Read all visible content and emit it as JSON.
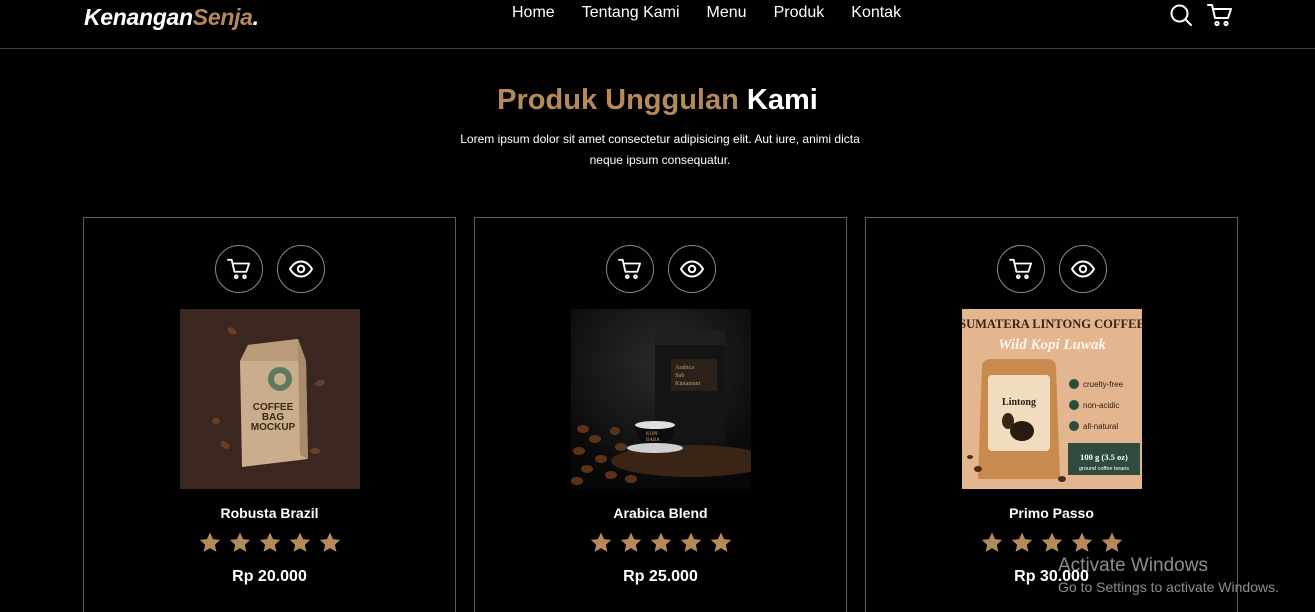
{
  "brand": {
    "name_main": "Kenangan",
    "name_accent": "Senja",
    "dot": "."
  },
  "nav": {
    "links": [
      "Home",
      "Tentang Kami",
      "Menu",
      "Produk",
      "Kontak"
    ],
    "icons": [
      "search-icon",
      "cart-icon"
    ]
  },
  "section": {
    "title_accent": "Produk Unggulan",
    "title_main": "Kami",
    "description": "Lorem ipsum dolor sit amet consectetur adipisicing elit. Aut iure, animi dicta neque ipsum consequatur."
  },
  "products": [
    {
      "name": "Robusta Brazil",
      "rating": 5,
      "price": "Rp 20.000",
      "image_text": [
        "COFFEE",
        "BAG",
        "MOCKUP"
      ]
    },
    {
      "name": "Arabica Blend",
      "rating": 5,
      "price": "Rp 25.000",
      "image_text": [
        "Arabica",
        "Sub",
        "Kintamani",
        "KOPI",
        "BARA"
      ]
    },
    {
      "name": "Primo Passo",
      "rating": 5,
      "price": "Rp 30.000",
      "image_text": [
        "SUMATERA LINTONG COFFEE",
        "Wild Kopi Luwak",
        "cruelty-free",
        "non-acidic",
        "all-natural",
        "Lintong",
        "100 g (3.5 oz)",
        "ground coffee beans"
      ]
    }
  ],
  "watermark": {
    "line1": "Activate Windows",
    "line2": "Go to Settings to activate Windows."
  },
  "colors": {
    "accent": "#b6895b",
    "background": "#010101",
    "border": "#5d5d5d"
  }
}
